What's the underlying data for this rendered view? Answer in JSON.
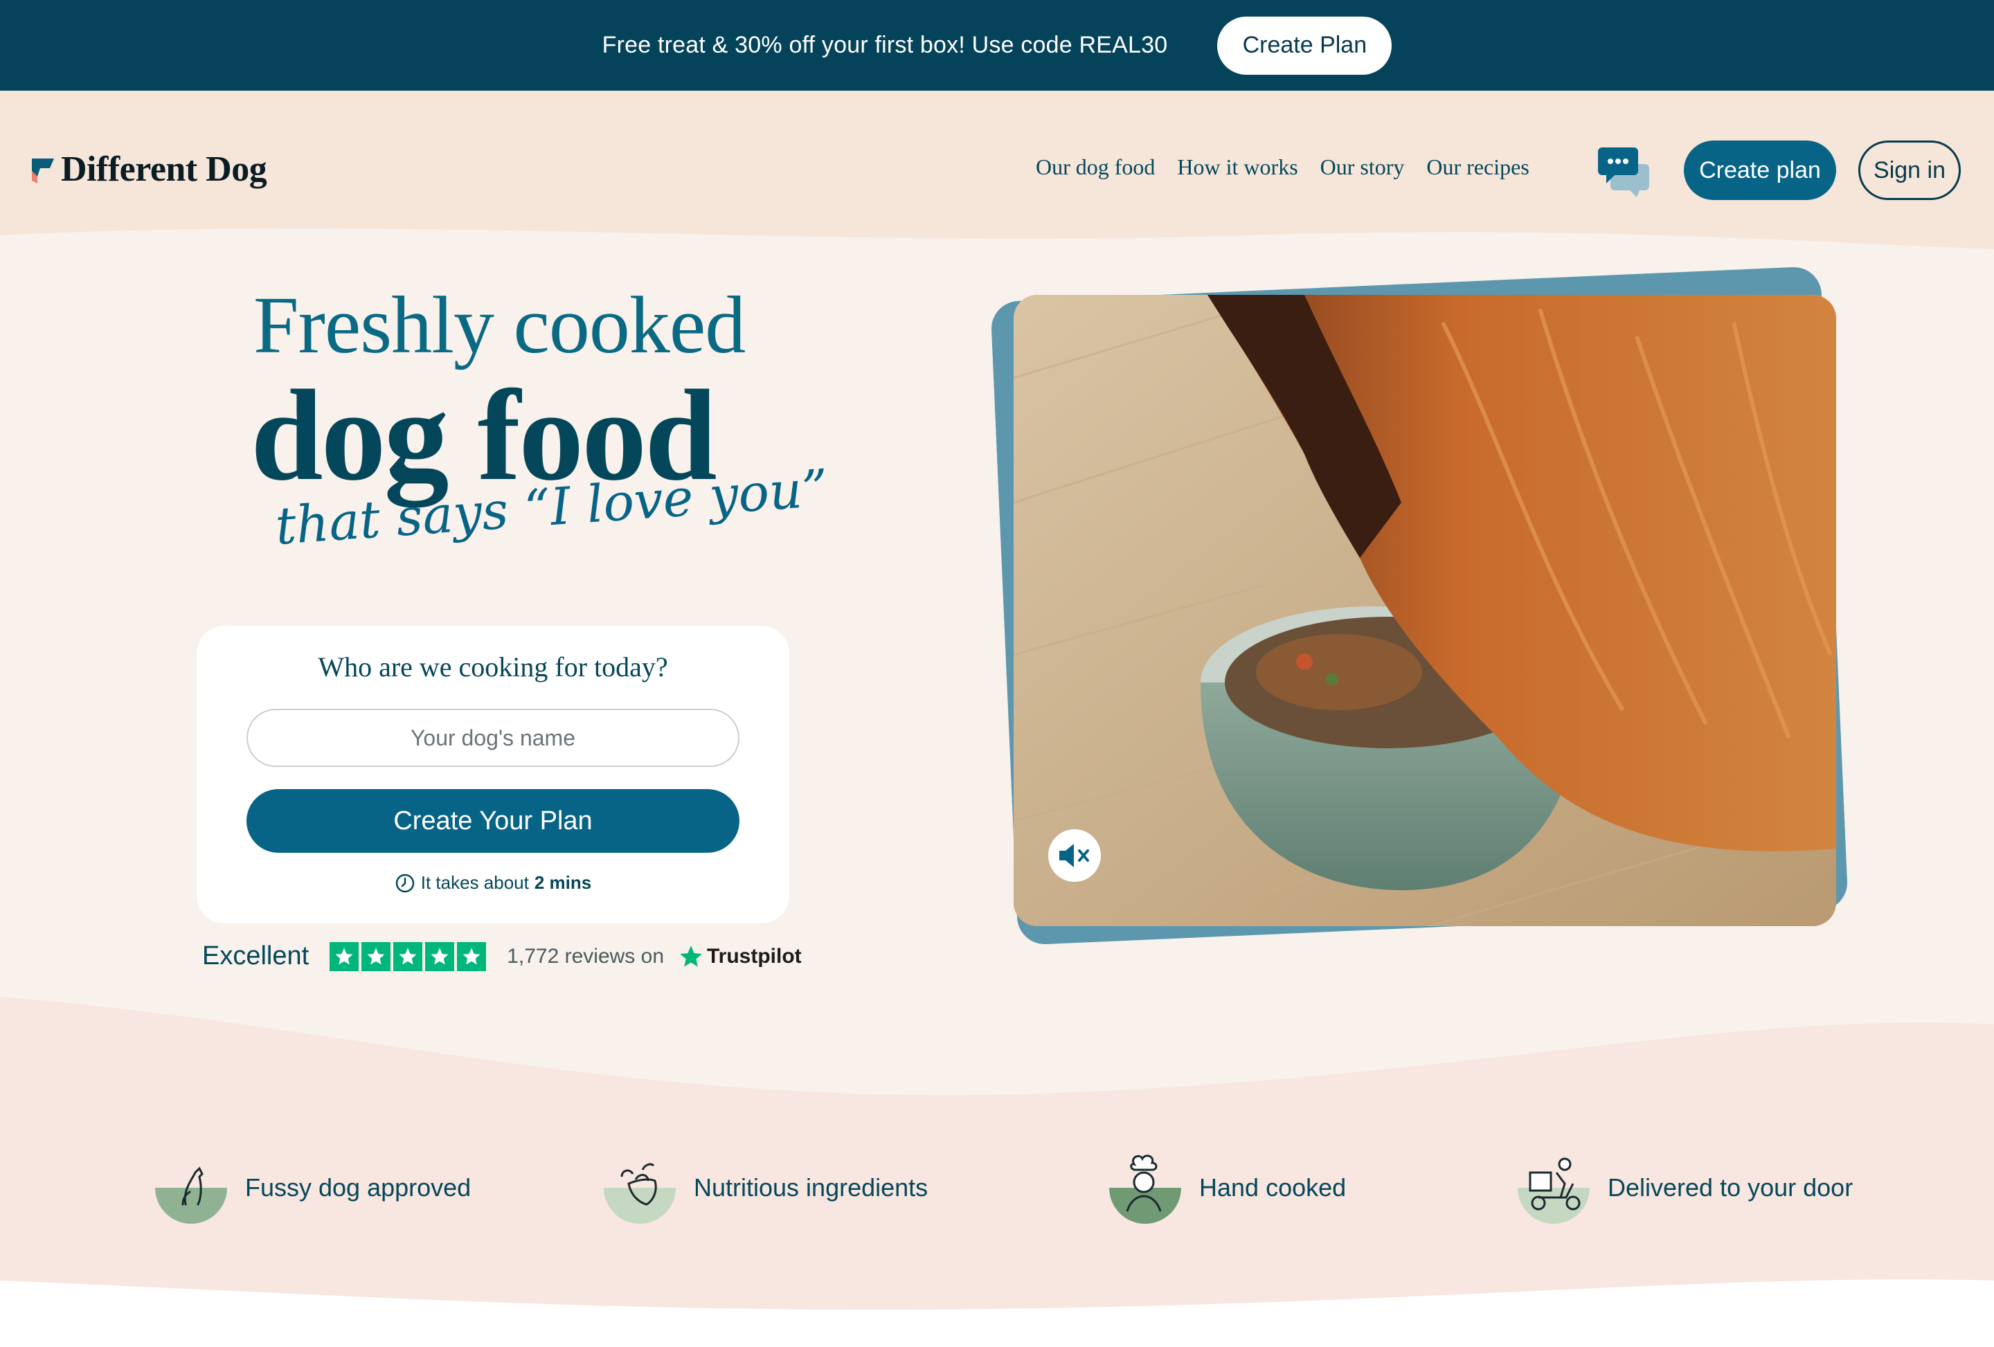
{
  "promo": {
    "text": "Free treat & 30% off your first box! Use code REAL30",
    "button": "Create Plan"
  },
  "nav": {
    "logo": "Different Dog",
    "links": [
      "Our dog food",
      "How it works",
      "Our story",
      "Our recipes"
    ],
    "chat_icon": "chat-bubbles-icon",
    "create_plan": "Create plan",
    "sign_in": "Sign in"
  },
  "hero": {
    "line1": "Freshly cooked",
    "line2": "dog food",
    "script": "that says “I love you”",
    "card": {
      "title": "Who are we cooking for today?",
      "input_placeholder": "Your dog's name",
      "button": "Create Your Plan",
      "note_prefix": "It takes about",
      "note_bold": "2 mins"
    },
    "trust": {
      "label": "Excellent",
      "stars": 5,
      "reviews": "1,772 reviews on",
      "brand": "Trustpilot"
    },
    "media": {
      "mute_icon": "speaker-muted-icon"
    }
  },
  "features": [
    {
      "label": "Fussy dog approved",
      "icon": "dog-sitting-icon"
    },
    {
      "label": "Nutritious ingredients",
      "icon": "vegetables-icon"
    },
    {
      "label": "Hand cooked",
      "icon": "chef-icon"
    },
    {
      "label": "Delivered to your door",
      "icon": "delivery-scooter-icon"
    }
  ],
  "colors": {
    "primary": "#076487",
    "dark": "#05435a",
    "cream": "#f8f1ec",
    "pink": "#f8e6e0",
    "trustpilot": "#00b67a"
  }
}
